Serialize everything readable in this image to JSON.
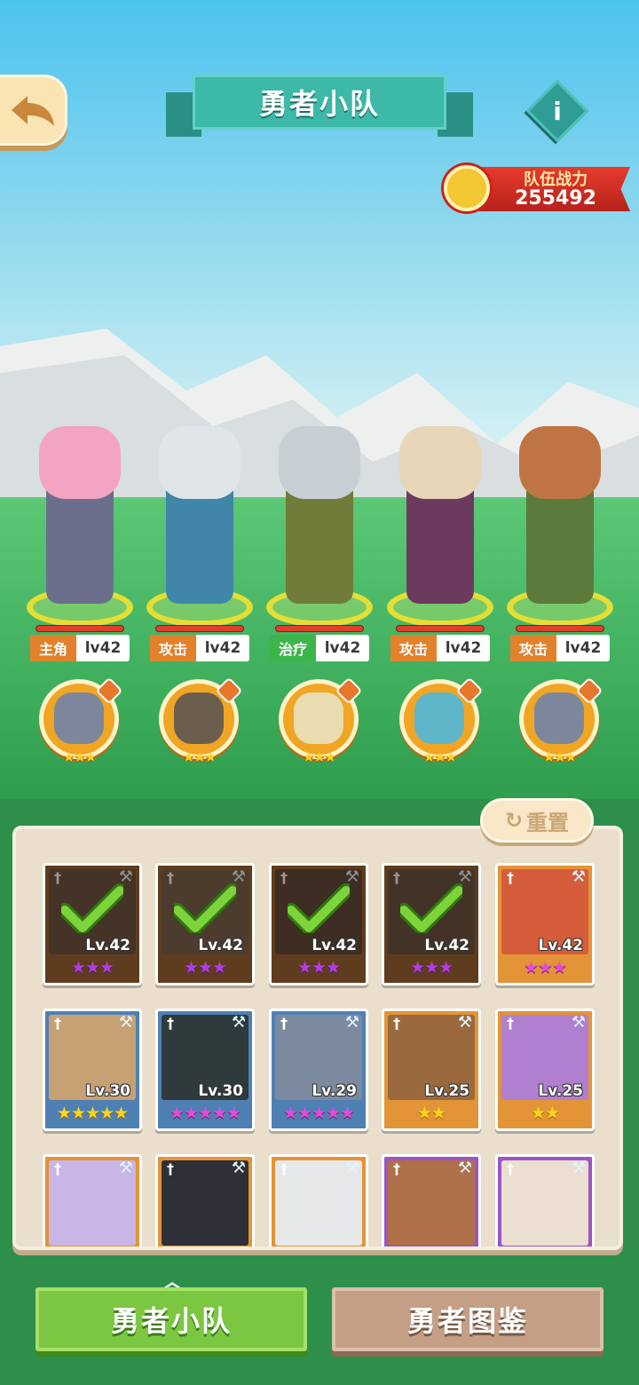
{
  "header": {
    "title": "勇者小队",
    "info_label": "i",
    "power_label": "队伍战力",
    "power_value": "255492"
  },
  "heroes": [
    {
      "role": "主角",
      "level": "lv42",
      "role_color": "#e2812c",
      "color_body": "#6b6f8c",
      "color_head": "#f2a4c2"
    },
    {
      "role": "攻击",
      "level": "lv42",
      "role_color": "#e2812c",
      "color_body": "#3f86a8",
      "color_head": "#dfe5e8"
    },
    {
      "role": "治疗",
      "level": "lv42",
      "role_color": "#3cb54a",
      "color_body": "#6f7c3a",
      "color_head": "#c8cfd4"
    },
    {
      "role": "攻击",
      "level": "lv42",
      "role_color": "#e2812c",
      "color_body": "#6c3a5e",
      "color_head": "#e8d6b8"
    },
    {
      "role": "攻击",
      "level": "lv42",
      "role_color": "#e2812c",
      "color_body": "#5b7a3c",
      "color_head": "#c07444"
    }
  ],
  "pets": [
    {
      "stars": "★★★",
      "color": "#7d879c"
    },
    {
      "stars": "★★★",
      "color": "#6b5e4e"
    },
    {
      "stars": "★★★",
      "color": "#e8dcb0"
    },
    {
      "stars": "★★★",
      "color": "#5fb6c9"
    },
    {
      "stars": "★★★",
      "color": "#7d879c"
    }
  ],
  "reset_label": "重置",
  "cards": [
    [
      {
        "level": "Lv.42",
        "stars": "★★★",
        "star_style": "purple",
        "bg": "brown",
        "selected": true
      },
      {
        "level": "Lv.42",
        "stars": "★★★",
        "star_style": "purple",
        "bg": "brown",
        "selected": true
      },
      {
        "level": "Lv.42",
        "stars": "★★★",
        "star_style": "purple",
        "bg": "brown",
        "selected": true
      },
      {
        "level": "Lv.42",
        "stars": "★★★",
        "star_style": "purple",
        "bg": "brown",
        "selected": true
      },
      {
        "level": "Lv.42",
        "stars": "★★★",
        "star_style": "pink",
        "bg": "orange",
        "selected": false
      }
    ],
    [
      {
        "level": "Lv.30",
        "stars": "★★★★★",
        "star_style": "gold",
        "bg": "blue",
        "selected": false
      },
      {
        "level": "Lv.30",
        "stars": "★★★★★",
        "star_style": "pink",
        "bg": "blue",
        "selected": false
      },
      {
        "level": "Lv.29",
        "stars": "★★★★★",
        "star_style": "pink",
        "bg": "blue",
        "selected": false
      },
      {
        "level": "Lv.25",
        "stars": "★★",
        "star_style": "gold",
        "bg": "orange",
        "selected": false
      },
      {
        "level": "Lv.25",
        "stars": "★★",
        "star_style": "gold",
        "bg": "orange",
        "selected": false
      }
    ],
    [
      {
        "level": "",
        "stars": "",
        "star_style": "gold",
        "bg": "orange",
        "selected": false
      },
      {
        "level": "",
        "stars": "",
        "star_style": "gold",
        "bg": "orange",
        "selected": false
      },
      {
        "level": "",
        "stars": "",
        "star_style": "gold",
        "bg": "orange",
        "selected": false
      },
      {
        "level": "",
        "stars": "",
        "star_style": "gold",
        "bg": "purple",
        "selected": false
      },
      {
        "level": "",
        "stars": "",
        "star_style": "gold",
        "bg": "purple",
        "selected": false
      }
    ]
  ],
  "tabs": {
    "team": "勇者小队",
    "collection": "勇者图鉴"
  },
  "colors": {
    "accent_green": "#7bc741",
    "power_red": "#e83b2c",
    "title_teal": "#3cb9a8"
  }
}
